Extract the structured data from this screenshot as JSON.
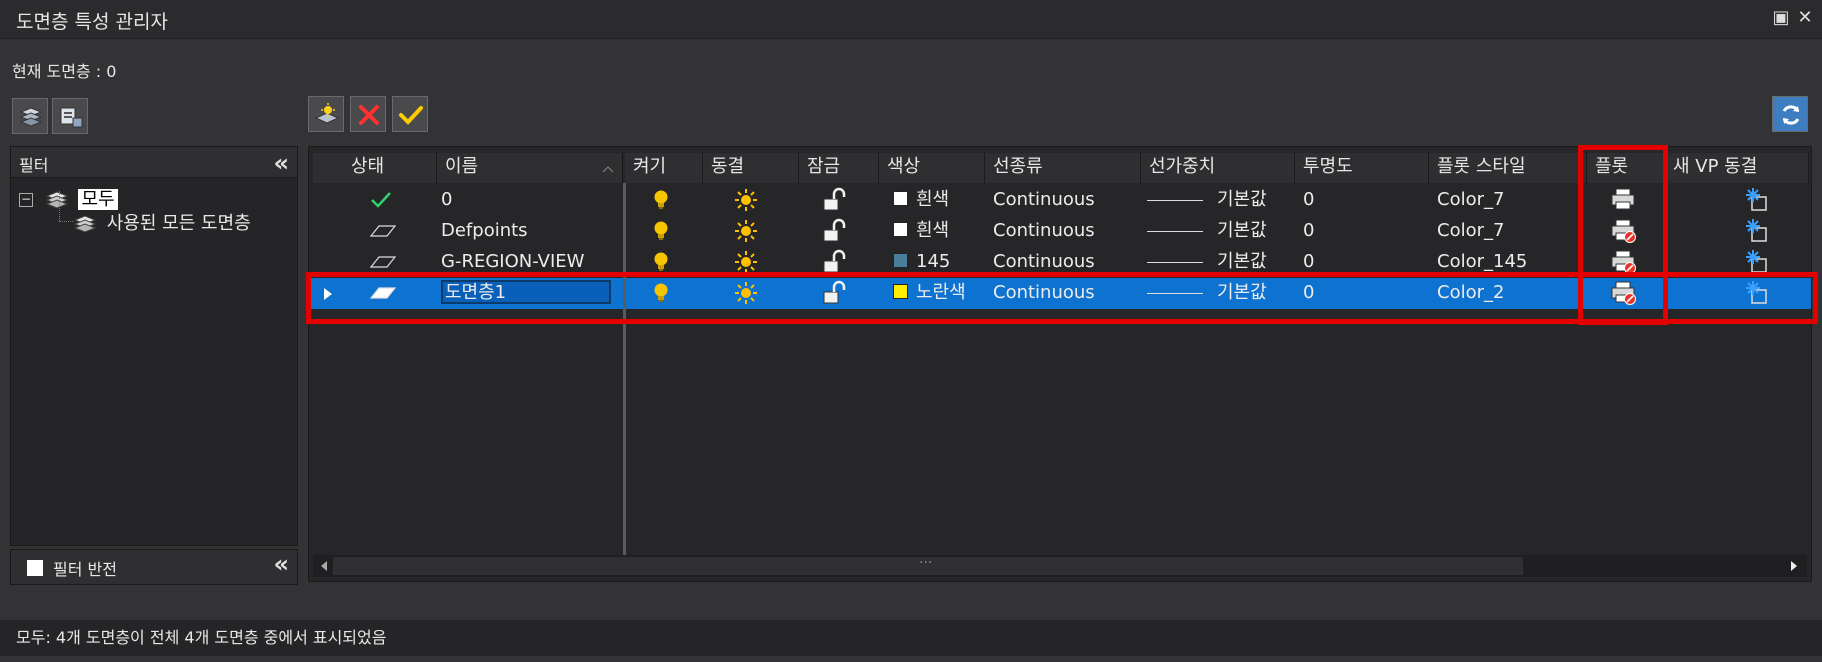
{
  "window": {
    "title": "도면층 특성 관리자",
    "restore_glyph": "▣",
    "close_glyph": "✕"
  },
  "current_layer_label": "현재 도면층 : 0",
  "filter_panel": {
    "header": "필터",
    "collapse_glyph": "«",
    "tree": [
      {
        "label": "모두"
      },
      {
        "label": "사용된 모든 도면층"
      }
    ],
    "invert_label": "필터 반전",
    "tree_toggle_glyph": "−"
  },
  "columns": [
    {
      "label": "상태"
    },
    {
      "label": "이름"
    },
    {
      "label": "켜기"
    },
    {
      "label": "동결"
    },
    {
      "label": "잠금"
    },
    {
      "label": "색상"
    },
    {
      "label": "선종류"
    },
    {
      "label": "선가중치"
    },
    {
      "label": "투명도"
    },
    {
      "label": "플롯 스타일"
    },
    {
      "label": "플롯"
    },
    {
      "label": "새 VP 동결"
    }
  ],
  "rows": [
    {
      "name": "0",
      "status": "current",
      "color_name": "흰색",
      "color_hex": "#ffffff",
      "linetype": "Continuous",
      "lineweight": "기본값",
      "transparency": "0",
      "plot_style": "Color_7",
      "plot": "enabled"
    },
    {
      "name": "Defpoints",
      "status": "layer",
      "color_name": "흰색",
      "color_hex": "#ffffff",
      "linetype": "Continuous",
      "lineweight": "기본값",
      "transparency": "0",
      "plot_style": "Color_7",
      "plot": "disabled"
    },
    {
      "name": "G-REGION-VIEW",
      "status": "layer",
      "color_name": "145",
      "color_hex": "#4a7f9c",
      "linetype": "Continuous",
      "lineweight": "기본값",
      "transparency": "0",
      "plot_style": "Color_145",
      "plot": "disabled"
    },
    {
      "name": "도면층1",
      "status": "layer",
      "color_name": "노란색",
      "color_hex": "#ffee00",
      "linetype": "Continuous",
      "lineweight": "기본값",
      "transparency": "0",
      "plot_style": "Color_2",
      "plot": "disabled",
      "selected": true
    }
  ],
  "status_bar": "모두: 4개 도면층이 전체 4개 도면층 중에서 표시되었음",
  "scroll_grip": "···",
  "icons": {
    "on": "lightbulb-icon",
    "freeze": "sun-icon",
    "lock": "unlocked-padlock-icon",
    "plot": "printer-icon",
    "new_vp_freeze": "snowflake-viewport-icon"
  },
  "colors": {
    "accent": "#0e72d0",
    "highlight": "#e50000",
    "check": "#2fd36a",
    "bulb": "#f7c400"
  }
}
